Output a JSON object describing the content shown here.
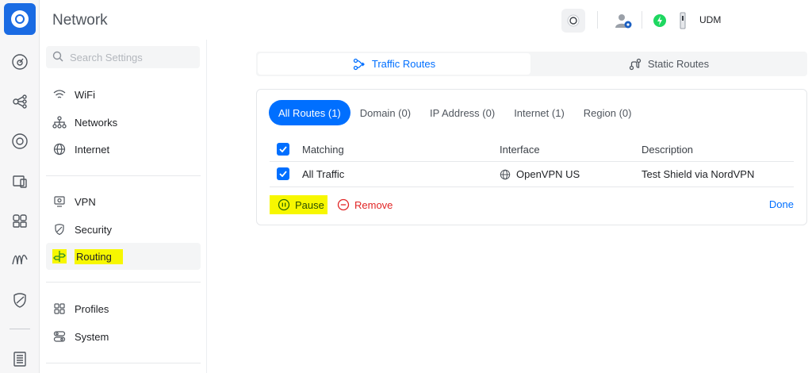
{
  "app": {
    "title": "Network"
  },
  "header": {
    "device": "UDM"
  },
  "rail": {
    "icons": [
      "dashboard-icon",
      "topology-icon",
      "devices-icon",
      "client-devices-icon",
      "ports-icon",
      "insights-icon",
      "protect-icon",
      "logs-icon"
    ]
  },
  "sidebar": {
    "search_placeholder": "Search Settings",
    "items": [
      {
        "label": "WiFi"
      },
      {
        "label": "Networks"
      },
      {
        "label": "Internet"
      },
      {
        "label": "VPN"
      },
      {
        "label": "Security"
      },
      {
        "label": "Routing"
      },
      {
        "label": "Profiles"
      },
      {
        "label": "System"
      }
    ],
    "active": "Routing"
  },
  "main": {
    "tabs": [
      {
        "label": "Traffic Routes",
        "active": true
      },
      {
        "label": "Static Routes",
        "active": false
      }
    ],
    "filters": [
      {
        "label": "All Routes (1)",
        "active": true
      },
      {
        "label": "Domain (0)"
      },
      {
        "label": "IP Address (0)"
      },
      {
        "label": "Internet (1)"
      },
      {
        "label": "Region (0)"
      }
    ],
    "table": {
      "columns": [
        "Matching",
        "Interface",
        "Description"
      ],
      "rows": [
        {
          "matching": "All Traffic",
          "interface": "OpenVPN US",
          "description": "Test Shield via NordVPN",
          "checked": true
        }
      ]
    },
    "actions": {
      "pause": "Pause",
      "remove": "Remove",
      "done": "Done"
    }
  },
  "colors": {
    "accent": "#006fff",
    "danger": "#e12525",
    "highlight": "#f7f700",
    "status_green": "#1ed760"
  }
}
